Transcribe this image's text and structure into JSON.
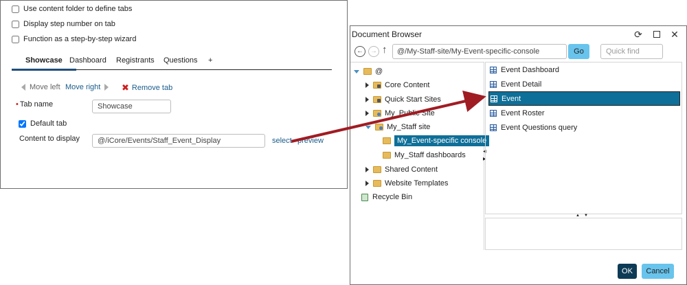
{
  "settings": {
    "checkboxes": [
      {
        "label": "Use content folder to define tabs",
        "checked": false
      },
      {
        "label": "Display step number on tab",
        "checked": false
      },
      {
        "label": "Function as a step-by-step wizard",
        "checked": false
      }
    ],
    "tabs": [
      "Showcase",
      "Dashboard",
      "Registrants",
      "Questions",
      "+"
    ],
    "active_tab": "Showcase",
    "move_left": "Move left",
    "move_right": "Move right",
    "remove_tab": "Remove tab",
    "tab_name_label": "Tab name",
    "tab_name_value": "Showcase",
    "default_tab_label": "Default tab",
    "default_tab_checked": true,
    "content_label": "Content to display",
    "content_value": "@/iCore/Events/Staff_Event_Display",
    "select_link": "select",
    "preview_link": "preview"
  },
  "browser": {
    "title": "Document Browser",
    "path": "@/My-Staff-site/My-Event-specific-console",
    "go_label": "Go",
    "quickfind_placeholder": "Quick find",
    "tree": {
      "root": "@",
      "items": [
        "Core Content",
        "Quick Start Sites",
        "My_Public Site",
        "My_Staff site",
        "My_Event-specific console",
        "My_Staff dashboards",
        "Shared Content",
        "Website Templates",
        "Recycle Bin"
      ]
    },
    "list": [
      "Event Dashboard",
      "Event Detail",
      "Event",
      "Event Roster",
      "Event Questions query"
    ],
    "selected_list_item": "Event",
    "ok_label": "OK",
    "cancel_label": "Cancel"
  },
  "colors": {
    "accent": "#0e6f98",
    "go_button": "#68c4ec",
    "ok_button": "#0d3b56",
    "annotation_arrow": "#a01c23",
    "link": "#1a5c8c"
  }
}
